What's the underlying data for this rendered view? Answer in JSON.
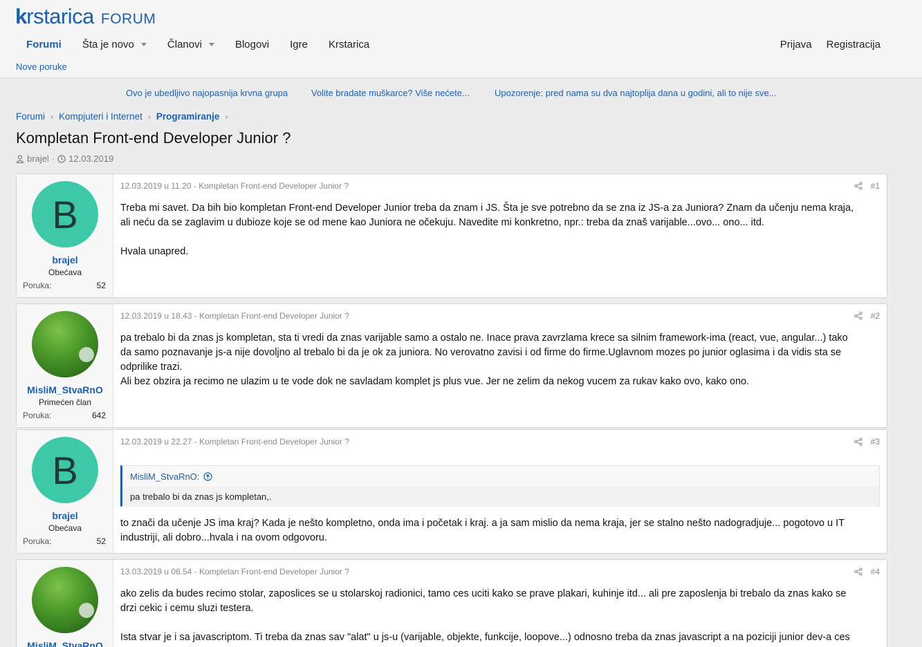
{
  "header": {
    "logo_text": "krstarica",
    "logo_suffix": "FORUM",
    "nav": [
      "Forumi",
      "Šta je novo",
      "Članovi",
      "Blogovi",
      "Igre",
      "Krstarica"
    ],
    "login": "Prijava",
    "register": "Registracija",
    "subnav": "Nove poruke"
  },
  "notices": [
    "Ovo je ubedljivo najopasnija krvna grupa",
    "Volite bradate muškarce? Više nećete...",
    "Upozorenje: pred nama su dva najtoplija dana u godini, ali to nije sve..."
  ],
  "breadcrumb": [
    "Forumi",
    "Kompjuteri i Internet",
    "Programiranje"
  ],
  "thread": {
    "title": "Kompletan Front-end Developer Junior ?",
    "author": "brajel",
    "date": "12.03.2019"
  },
  "posts": [
    {
      "username": "brajel",
      "usertitle": "Obećava",
      "stat_label": "Poruka:",
      "stat_value": "52",
      "avatar_letter": "B",
      "header": "12.03.2019 u 11.20 - Kompletan Front-end Developer Junior ?",
      "number": "#1",
      "body": [
        "Treba mi savet. Da bih bio kompletan Front-end Developer Junior treba da znam i JS. Šta je sve potrebno da se zna iz JS-a za Juniora? Znam da učenju nema kraja,",
        "ali neću da se zaglavim u dubioze koje se od mene kao Juniora ne očekuju. Navedite mi konkretno, npr.: treba da znaš varijable...ovo... ono... itd.",
        "Hvala unapred."
      ]
    },
    {
      "username": "MisliM_StvaRnO",
      "usertitle": "Primećen član",
      "stat_label": "Poruka:",
      "stat_value": "642",
      "header": "12.03.2019 u 18.43 - Kompletan Front-end Developer Junior ?",
      "number": "#2",
      "body": [
        "pa trebalo bi da znas js kompletan, sta ti vredi da znas varijable samo a ostalo ne. Inace prava zavrzlama krece sa silnim framework-ima (react, vue, angular...) tako",
        "da samo poznavanje js-a nije dovoljno al trebalo bi da je ok za juniora. No verovatno zavisi i od firme do firme.Uglavnom mozes po junior oglasima i da vidis sta se",
        "odprilike trazi.",
        "Ali bez obzira ja recimo ne ulazim u te vode dok ne savladam komplet js plus vue. Jer ne zelim da nekog vucem za rukav kako ovo, kako ono."
      ]
    },
    {
      "username": "brajel",
      "usertitle": "Obećava",
      "stat_label": "Poruka:",
      "stat_value": "52",
      "avatar_letter": "B",
      "header": "12.03.2019 u 22.27 - Kompletan Front-end Developer Junior ?",
      "number": "#3",
      "quote_author": "MisliM_StvaRnO:",
      "quote_text": "pa trebalo bi da znas js kompletan,.",
      "body": [
        "to znači da učenje JS ima kraj? Kada je nešto kompletno, onda ima i početak i kraj. a ja sam mislio da nema kraja, jer se stalno nešto nadogradjuje... pogotovo u IT",
        "industriji, ali dobro...hvala i na ovom odgovoru."
      ]
    },
    {
      "username": "MisliM_StvaRnO",
      "header": "13.03.2019 u 06.54 - Kompletan Front-end Developer Junior ?",
      "number": "#4",
      "body": [
        "ako zelis da budes recimo stolar, zaposlices se u stolarskoj radionici, tamo ces uciti kako se prave plakari, kuhinje itd... ali pre zaposlenja bi trebalo da znas kako se",
        "drzi cekic i cemu sluzi testera.",
        "Ista stvar je i sa javascriptom. Ti treba da znas sav \"alat\" u js-u (varijable, objekte, funkcije, loopove...) odnosno treba da znas javascript a na poziciji junior dev-a ces"
      ]
    }
  ]
}
